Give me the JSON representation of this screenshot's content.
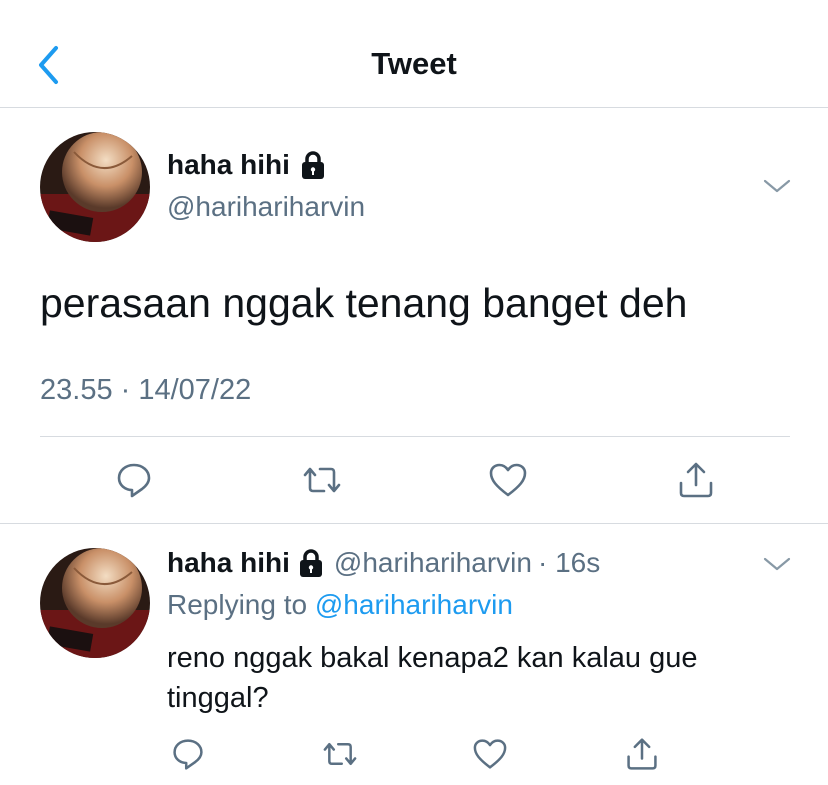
{
  "header": {
    "title": "Tweet",
    "back_icon": "chevron-left-icon"
  },
  "main_tweet": {
    "display_name": "haha hihi",
    "handle": "@harihariharvin",
    "text": "perasaan nggak tenang banget deh",
    "timestamp": "23.55 · 14/07/22",
    "protected_icon": "lock-icon",
    "menu_icon": "chevron-down-icon",
    "actions": [
      "reply-icon",
      "retweet-icon",
      "like-icon",
      "share-icon"
    ]
  },
  "reply": {
    "display_name": "haha hihi",
    "handle": "@harihariharvin",
    "time": "· 16s",
    "replying_prefix": "Replying to",
    "replying_to": "@harihariharvin",
    "text": "reno nggak bakal kenapa2 kan kalau gue tinggal?",
    "protected_icon": "lock-icon",
    "menu_icon": "chevron-down-icon",
    "actions": [
      "reply-icon",
      "retweet-icon",
      "like-icon",
      "share-icon"
    ]
  },
  "colors": {
    "accent": "#1d9bf0",
    "secondary_text": "#5b7083",
    "divider": "#d7dbe0"
  }
}
